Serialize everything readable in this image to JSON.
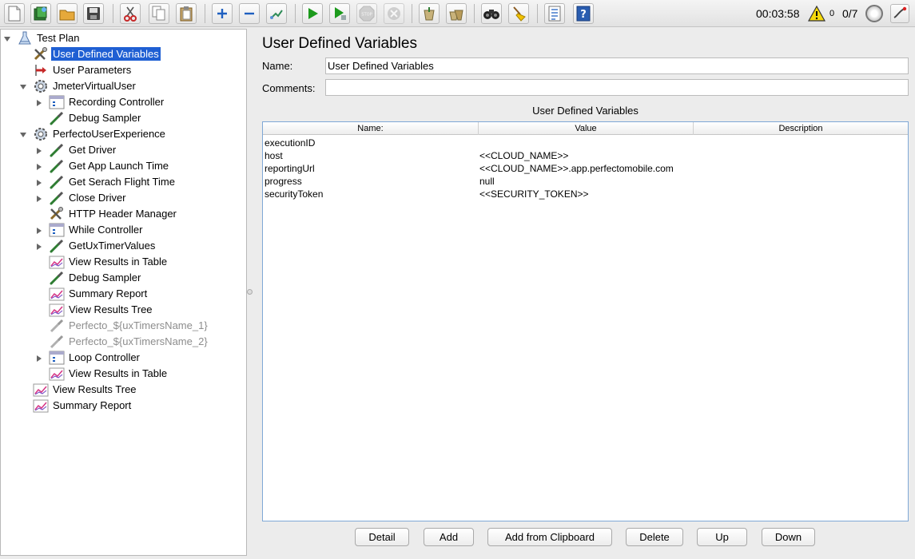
{
  "toolbar": {
    "buttons": [
      {
        "name": "new-icon"
      },
      {
        "name": "templates-icon"
      },
      {
        "name": "open-icon"
      },
      {
        "name": "save-icon"
      },
      {
        "name": "cut-icon"
      },
      {
        "name": "copy-icon"
      },
      {
        "name": "paste-icon"
      },
      {
        "name": "expand-icon"
      },
      {
        "name": "collapse-icon"
      },
      {
        "name": "toggle-icon"
      },
      {
        "name": "start-icon"
      },
      {
        "name": "start-no-pauses-icon"
      },
      {
        "name": "stop-icon"
      },
      {
        "name": "shutdown-icon"
      },
      {
        "name": "clear-icon"
      },
      {
        "name": "clear-all-icon"
      },
      {
        "name": "search-icon"
      },
      {
        "name": "reset-search-icon"
      },
      {
        "name": "function-helper-icon"
      },
      {
        "name": "help-icon"
      }
    ],
    "stop_label": "STOP",
    "help_label": "?",
    "elapsed_time": "00:03:58",
    "warning_count": "0",
    "threads": "0/7"
  },
  "tree": {
    "items": [
      {
        "label": "Test Plan",
        "level": 0,
        "expanded": true,
        "icon": "test-plan-icon"
      },
      {
        "label": "User Defined Variables",
        "level": 1,
        "selected": true,
        "icon": "config-wrench-icon"
      },
      {
        "label": "User Parameters",
        "level": 1,
        "icon": "preprocessor-icon"
      },
      {
        "label": "JmeterVirtualUser",
        "level": 1,
        "expanded": true,
        "icon": "thread-group-gear-icon"
      },
      {
        "label": "Recording Controller",
        "level": 2,
        "collapsed": true,
        "icon": "controller-icon"
      },
      {
        "label": "Debug Sampler",
        "level": 2,
        "icon": "sampler-pipette-icon"
      },
      {
        "label": "PerfectoUserExperience",
        "level": 1,
        "expanded": true,
        "icon": "thread-group-gear-icon"
      },
      {
        "label": "Get Driver",
        "level": 2,
        "collapsed": true,
        "icon": "sampler-pipette-icon"
      },
      {
        "label": "Get App Launch Time",
        "level": 2,
        "collapsed": true,
        "icon": "sampler-pipette-icon"
      },
      {
        "label": "Get Serach Flight Time",
        "level": 2,
        "collapsed": true,
        "icon": "sampler-pipette-icon"
      },
      {
        "label": "Close Driver",
        "level": 2,
        "collapsed": true,
        "icon": "sampler-pipette-icon"
      },
      {
        "label": "HTTP Header Manager",
        "level": 2,
        "icon": "config-wrench-icon"
      },
      {
        "label": "While Controller",
        "level": 2,
        "collapsed": true,
        "icon": "controller-icon"
      },
      {
        "label": "GetUxTimerValues",
        "level": 2,
        "collapsed": true,
        "icon": "sampler-pipette-icon"
      },
      {
        "label": "View Results in Table",
        "level": 2,
        "icon": "listener-graph-icon"
      },
      {
        "label": "Debug Sampler",
        "level": 2,
        "icon": "sampler-pipette-icon"
      },
      {
        "label": "Summary Report",
        "level": 2,
        "icon": "listener-graph-icon"
      },
      {
        "label": "View Results Tree",
        "level": 2,
        "icon": "listener-graph-icon"
      },
      {
        "label": "Perfecto_${uxTimersName_1}",
        "level": 2,
        "disabled": true,
        "icon": "sampler-pipette-disabled-icon"
      },
      {
        "label": "Perfecto_${uxTimersName_2}",
        "level": 2,
        "disabled": true,
        "icon": "sampler-pipette-disabled-icon"
      },
      {
        "label": "Loop Controller",
        "level": 2,
        "collapsed": true,
        "icon": "controller-icon"
      },
      {
        "label": "View Results in Table",
        "level": 2,
        "icon": "listener-graph-icon"
      },
      {
        "label": "View Results Tree",
        "level": 1,
        "icon": "listener-graph-icon"
      },
      {
        "label": "Summary Report",
        "level": 1,
        "icon": "listener-graph-icon"
      }
    ]
  },
  "main": {
    "title": "User Defined Variables",
    "name_label": "Name:",
    "name_value": "User Defined Variables",
    "comments_label": "Comments:",
    "comments_value": "",
    "table_title": "User Defined Variables",
    "columns": [
      "Name:",
      "Value",
      "Description"
    ],
    "rows": [
      {
        "name": "executionID",
        "value": "",
        "description": ""
      },
      {
        "name": "host",
        "value": "<<CLOUD_NAME>>",
        "description": ""
      },
      {
        "name": "reportingUrl",
        "value": "<<CLOUD_NAME>>.app.perfectomobile.com",
        "description": ""
      },
      {
        "name": "progress",
        "value": "null",
        "description": ""
      },
      {
        "name": "securityToken",
        "value": "<<SECURITY_TOKEN>>",
        "description": ""
      }
    ],
    "buttons": [
      "Detail",
      "Add",
      "Add from Clipboard",
      "Delete",
      "Up",
      "Down"
    ]
  },
  "colors": {
    "selection": "#1f5fd3",
    "table_border": "#7fa8d6",
    "start_green": "#1c9a1c",
    "warning_yellow": "#f5d90a"
  }
}
